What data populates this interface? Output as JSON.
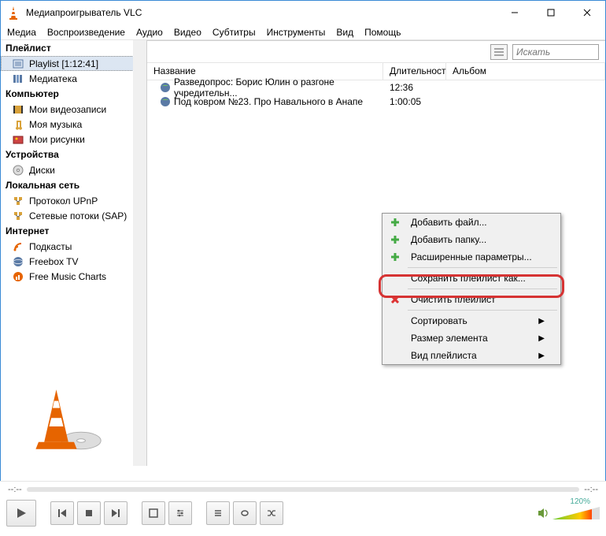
{
  "window": {
    "title": "Медиапроигрыватель VLC"
  },
  "menu": {
    "items": [
      "Медиа",
      "Воспроизведение",
      "Аудио",
      "Видео",
      "Субтитры",
      "Инструменты",
      "Вид",
      "Помощь"
    ]
  },
  "sidebar": {
    "playlist_header": "Плейлист",
    "playlist_item": "Playlist [1:12:41]",
    "mediateka": "Медиатека",
    "computer_header": "Компьютер",
    "videos": "Мои видеозаписи",
    "music": "Моя музыка",
    "pictures": "Мои рисунки",
    "devices_header": "Устройства",
    "disks": "Диски",
    "lan_header": "Локальная сеть",
    "upnp": "Протокол UPnP",
    "sap": "Сетевые потоки (SAP)",
    "internet_header": "Интернет",
    "podcasts": "Подкасты",
    "freebox": "Freebox TV",
    "jamendo": "Free Music Charts"
  },
  "search": {
    "placeholder": "Искать"
  },
  "columns": {
    "title": "Название",
    "duration": "Длительност",
    "album": "Альбом"
  },
  "rows": [
    {
      "title": "Разведопрос: Борис Юлин о разгоне учредительн...",
      "duration": "12:36"
    },
    {
      "title": "Под ковром №23. Про Навального в Анапе",
      "duration": "1:00:05"
    }
  ],
  "context": {
    "add_file": "Добавить файл...",
    "add_folder": "Добавить папку...",
    "advanced": "Расширенные параметры...",
    "save_as": "Сохранить плейлист как...",
    "clear": "Очистить плейлист",
    "sort": "Сортировать",
    "item_size": "Размер элемента",
    "view": "Вид плейлиста"
  },
  "seek": {
    "left": "--:--",
    "right": "--:--"
  },
  "volume": {
    "label": "120%"
  }
}
